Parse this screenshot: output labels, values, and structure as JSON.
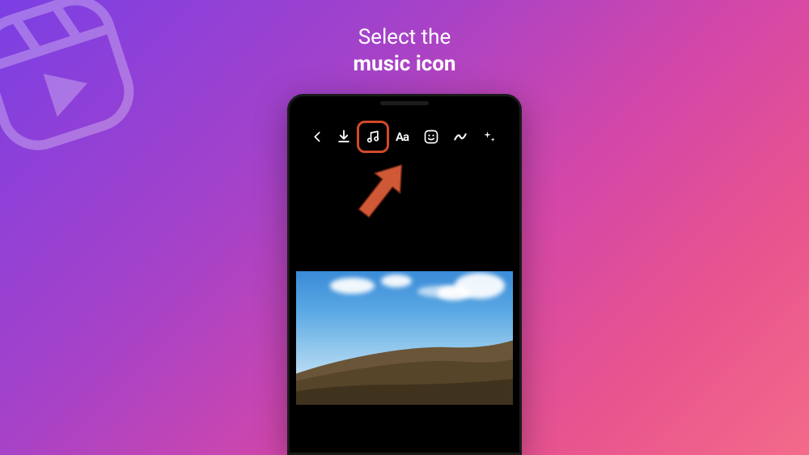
{
  "tutorial": {
    "title_line1": "Select the",
    "title_line2": "music icon"
  },
  "toolbar": {
    "back": "Back",
    "download": "Download",
    "music": "Music",
    "text": "Aa",
    "sticker": "Sticker",
    "draw": "Draw",
    "effects": "Effects"
  },
  "highlight_target": "music-icon",
  "colors": {
    "highlight": "#d14a2a",
    "arrow": "#cf5837"
  }
}
